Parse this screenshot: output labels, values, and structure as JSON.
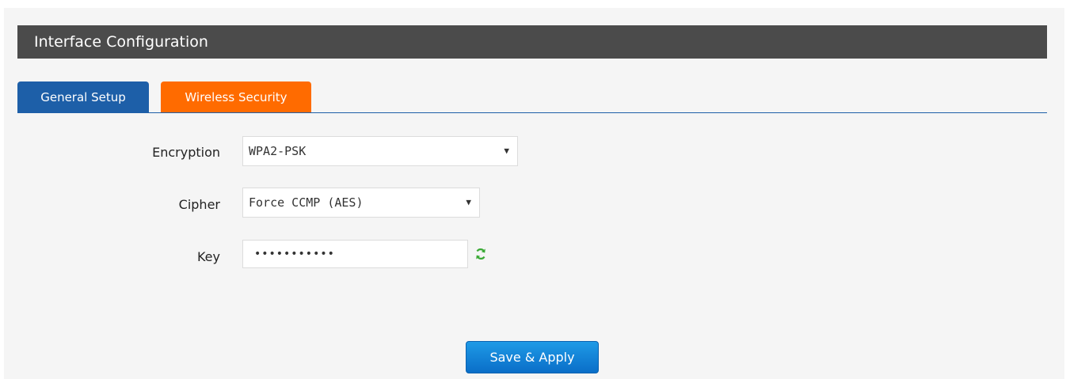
{
  "header": {
    "title": "Interface Configuration"
  },
  "tabs": [
    {
      "label": "General Setup",
      "active": false,
      "color": "#1d5fa8"
    },
    {
      "label": "Wireless Security",
      "active": true,
      "color": "#ff6b00"
    }
  ],
  "form": {
    "encryption": {
      "label": "Encryption",
      "value": "WPA2-PSK"
    },
    "cipher": {
      "label": "Cipher",
      "value": "Force CCMP (AES)"
    },
    "key": {
      "label": "Key",
      "value": "•••••••••••",
      "icon": "refresh-icon"
    }
  },
  "actions": {
    "save_label": "Save & Apply"
  }
}
